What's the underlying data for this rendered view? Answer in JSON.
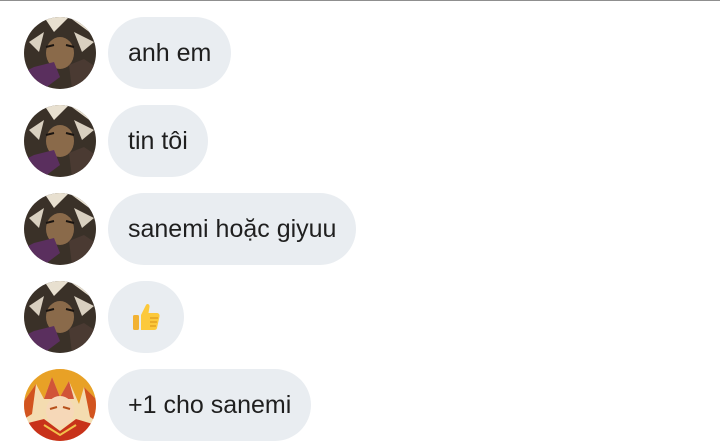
{
  "messages": [
    {
      "sender": "avatar-dark-hair",
      "text": "anh em"
    },
    {
      "sender": "avatar-dark-hair",
      "text": "tin tôi"
    },
    {
      "sender": "avatar-dark-hair",
      "text": "sanemi hoặc giyuu"
    },
    {
      "sender": "avatar-dark-hair",
      "emoji": "thumbs-up-icon"
    },
    {
      "sender": "avatar-flame-hair",
      "text": "+1 cho sanemi"
    }
  ],
  "colors": {
    "bubble": "#e9edf1",
    "text": "#1f1f1f",
    "divider": "#8f8f8f"
  }
}
